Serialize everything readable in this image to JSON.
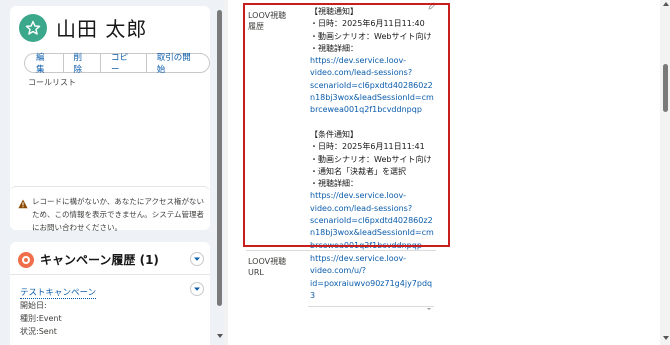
{
  "record": {
    "name": "山田 太郎",
    "icon": "star-icon",
    "buttons": [
      "編集",
      "削除",
      "コピー",
      "取引の開始"
    ],
    "follow_list": "コールリスト"
  },
  "access_notice": {
    "icon": "warning-icon",
    "text": "レコードに構がないか、あなたにアクセス権がないため、この情報を表示できません。システム管理者にお問い合わせください。"
  },
  "campaign": {
    "title": "キャンペーン履歴 (1)",
    "item_link": "テストキャンペーン",
    "fields": [
      {
        "label": "開始日:",
        "value": ""
      },
      {
        "label": "種別:",
        "value": "Event"
      },
      {
        "label": "状況:",
        "value": "Sent"
      }
    ]
  },
  "details": {
    "history_label_1": "LOOV視聴",
    "history_label_2": "履歴",
    "history_lines": [
      {
        "type": "text",
        "text": "【視聴通知】"
      },
      {
        "type": "text",
        "text": "・日時：2025年6月11日11:40"
      },
      {
        "type": "text",
        "text": "・動画シナリオ：Webサイト向け"
      },
      {
        "type": "text",
        "text": "・視聴詳細："
      },
      {
        "type": "link",
        "text": "https://dev.service.loov-"
      },
      {
        "type": "link",
        "text": "video.com/lead-sessions?"
      },
      {
        "type": "link",
        "text": "scenarioId=cl6pxdtd402860z2"
      },
      {
        "type": "link",
        "text": "n18bj3wox&leadSessionId=cm"
      },
      {
        "type": "link",
        "text": "brcewea001q2f1bcvddnpqp"
      },
      {
        "type": "text",
        "text": " "
      },
      {
        "type": "text",
        "text": "【条件通知】"
      },
      {
        "type": "text",
        "text": "・日時：2025年6月11日11:41"
      },
      {
        "type": "text",
        "text": "・動画シナリオ：Webサイト向け"
      },
      {
        "type": "text",
        "text": "・通知名「決裁者」を選択"
      },
      {
        "type": "text",
        "text": "・視聴詳細："
      },
      {
        "type": "link",
        "text": "https://dev.service.loov-"
      },
      {
        "type": "link",
        "text": "video.com/lead-sessions?"
      },
      {
        "type": "link",
        "text": "scenarioId=cl6pxdtd402860z2"
      },
      {
        "type": "link",
        "text": "n18bj3wox&leadSessionId=cm"
      },
      {
        "type": "link",
        "text": "brcewea001q2f1bcvddnpqp"
      }
    ],
    "url_label_1": "LOOV視聴",
    "url_label_2": "URL",
    "url_lines": [
      "https://dev.service.loov-",
      "video.com/u/?",
      "id=poxraiuwvo90z71g4jy7pdq",
      "3"
    ]
  },
  "colors": {
    "link": "#0b5cab",
    "highlight_border": "#c81e1e",
    "avatar": "#3ba88c",
    "campaign_icon": "#f06f4a"
  }
}
